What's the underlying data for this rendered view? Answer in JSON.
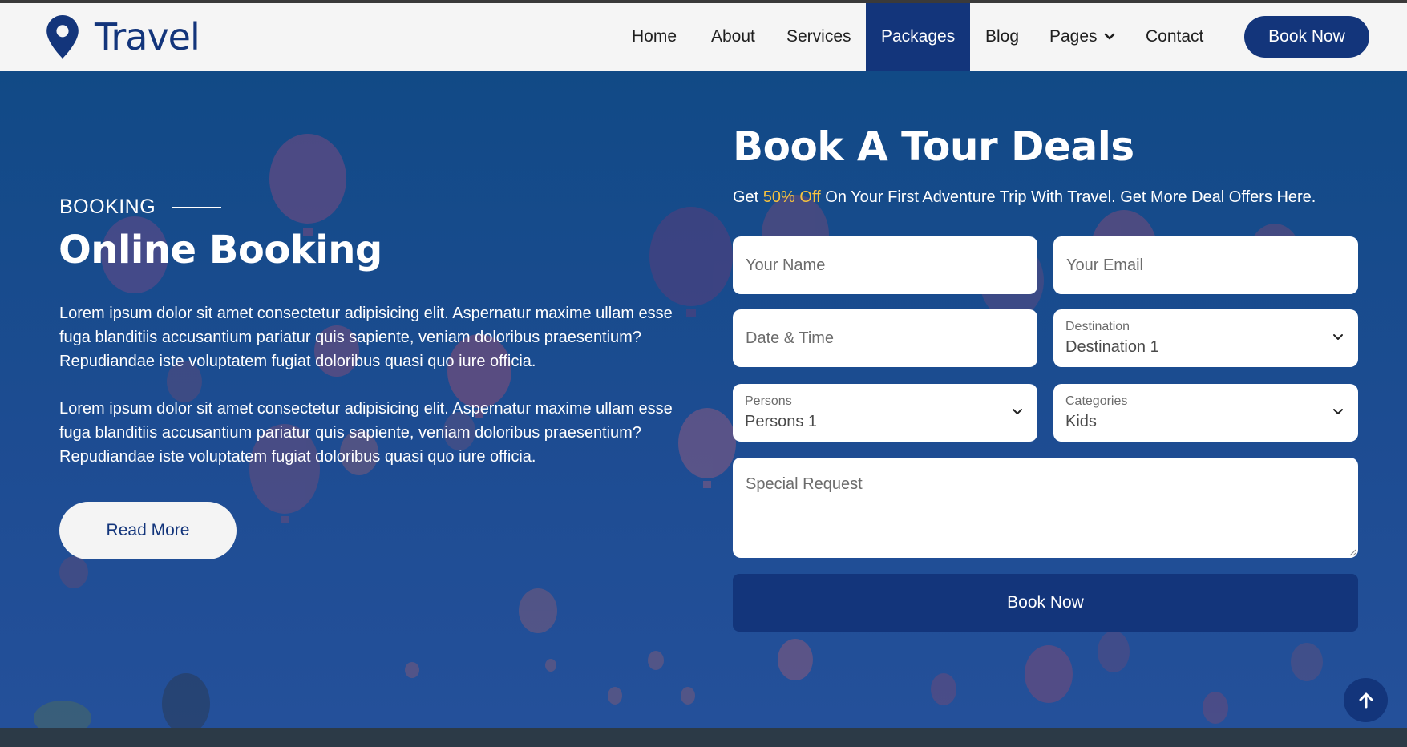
{
  "brand": {
    "name": "Travel",
    "icon": "map-pin-icon"
  },
  "nav": {
    "items": [
      {
        "label": "Home"
      },
      {
        "label": "About"
      },
      {
        "label": "Services"
      },
      {
        "label": "Packages",
        "active": true
      },
      {
        "label": "Blog"
      },
      {
        "label": "Pages",
        "has_dropdown": true
      },
      {
        "label": "Contact"
      }
    ],
    "cta_label": "Book Now"
  },
  "hero": {
    "eyebrow": "BOOKING",
    "title": "Online Booking",
    "paragraphs": [
      "Lorem ipsum dolor sit amet consectetur adipisicing elit. Aspernatur maxime ullam esse fuga blanditiis accusantium pariatur quis sapiente, veniam doloribus praesentium? Repudiandae iste voluptatem fugiat doloribus quasi quo iure officia.",
      "Lorem ipsum dolor sit amet consectetur adipisicing elit. Aspernatur maxime ullam esse fuga blanditiis accusantium pariatur quis sapiente, veniam doloribus praesentium? Repudiandae iste voluptatem fugiat doloribus quasi quo iure officia."
    ],
    "read_more_label": "Read More"
  },
  "form": {
    "title": "Book A Tour Deals",
    "subtitle_pre": "Get ",
    "subtitle_highlight": "50% Off",
    "subtitle_post": " On Your First Adventure Trip With Travel. Get More Deal Offers Here.",
    "name_placeholder": "Your Name",
    "email_placeholder": "Your Email",
    "date_placeholder": "Date & Time",
    "destination": {
      "label": "Destination",
      "value": "Destination 1"
    },
    "persons": {
      "label": "Persons",
      "value": "Persons 1"
    },
    "categories": {
      "label": "Categories",
      "value": "Kids"
    },
    "request_placeholder": "Special Request",
    "submit_label": "Book Now"
  },
  "back_to_top_icon": "arrow-up-icon",
  "colors": {
    "primary": "#13357b",
    "hero_overlay": "#1e4c8c",
    "highlight": "#f6c23e",
    "nav_bg": "#f5f5f5"
  }
}
